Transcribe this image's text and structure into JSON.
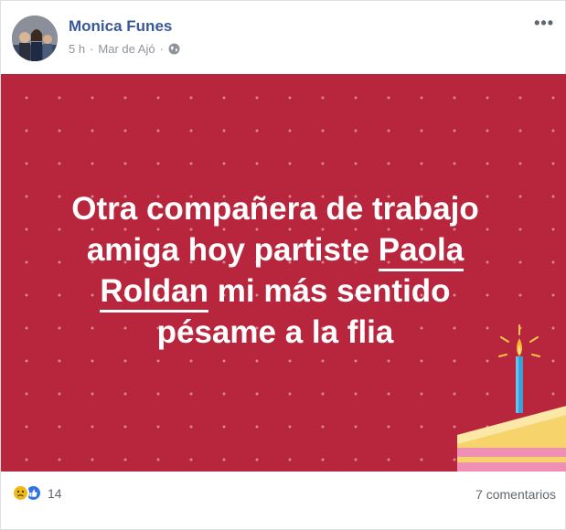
{
  "post": {
    "author": "Monica Funes",
    "time": "5 h",
    "separator": "·",
    "location": "Mar de Ajó",
    "separator2": "·",
    "more_label": "•••",
    "message": {
      "line1": "Otra compañera de trabajo",
      "line2_prefix": "amiga hoy partiste ",
      "mention_part1": "Paola",
      "mention_part2": "Roldan",
      "line3_suffix": " mi más sentido",
      "line4": "pésame a la flia"
    },
    "banner_color": "#b8263d",
    "reaction_count": "14",
    "reaction_icons": [
      "sad-icon",
      "like-icon"
    ],
    "comments_label": "7 comentarios"
  }
}
